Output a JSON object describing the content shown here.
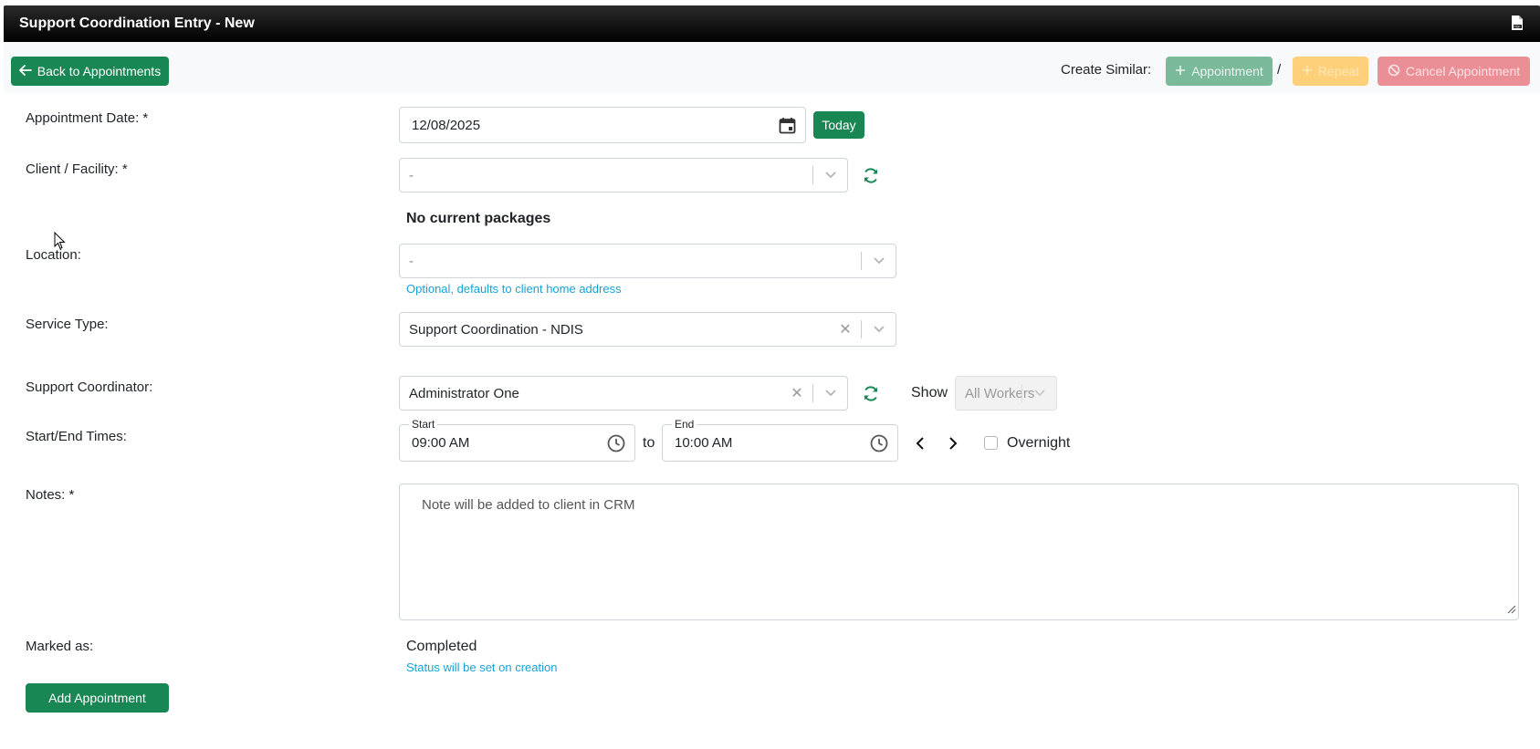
{
  "window": {
    "title": "Support Coordination Entry - New"
  },
  "toolbar": {
    "back_label": "Back to Appointments",
    "create_similar_label": "Create Similar:",
    "appointment_label": "Appointment",
    "separator": "/",
    "repeat_label": "Repeat",
    "cancel_label": "Cancel Appointment"
  },
  "form": {
    "date": {
      "label": "Appointment Date: *",
      "value": "12/08/2025",
      "today_label": "Today"
    },
    "client": {
      "label": "Client / Facility: *",
      "value": "-",
      "packages_text": "No current packages"
    },
    "location": {
      "label": "Location:",
      "value": "-",
      "hint": "Optional, defaults to client home address"
    },
    "service_type": {
      "label": "Service Type:",
      "value": "Support Coordination - NDIS"
    },
    "coordinator": {
      "label": "Support Coordinator:",
      "value": "Administrator One",
      "show_label": "Show",
      "show_value": "All Workers"
    },
    "times": {
      "label": "Start/End Times:",
      "start_label": "Start",
      "start_value": "09:00 AM",
      "to_label": "to",
      "end_label": "End",
      "end_value": "10:00 AM",
      "overnight_label": "Overnight",
      "overnight_checked": false
    },
    "notes": {
      "label": "Notes: *",
      "placeholder": "Note will be added to client in CRM"
    },
    "status": {
      "label": "Marked as:",
      "value": "Completed",
      "hint": "Status will be set on creation"
    },
    "submit_label": "Add Appointment"
  },
  "colors": {
    "primary_green": "#198754",
    "hint_blue": "#17a2d6",
    "title_bar": "#000000",
    "warning_disabled": "#ffd07a",
    "danger_disabled": "#eb8f97"
  }
}
